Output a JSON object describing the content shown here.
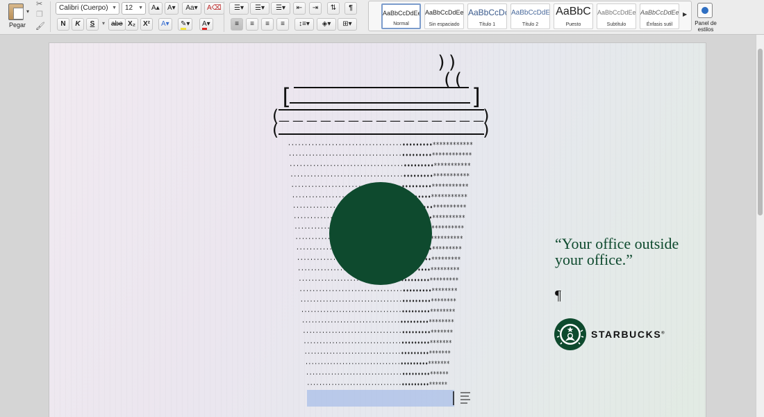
{
  "ribbon": {
    "paste_label": "Pegar",
    "font_name": "Calibri (Cuerpo)",
    "font_size": "12",
    "grow_font": "A▴",
    "shrink_font": "A▾",
    "bold": "N",
    "italic": "K",
    "underline": "S",
    "strikethrough": "abe",
    "subscript": "X₂",
    "superscript": "X²",
    "pilcrow": "¶",
    "styles": [
      {
        "sample": "AaBbCcDdEe",
        "name": "Normal",
        "selected": true
      },
      {
        "sample": "AaBbCcDdEe",
        "name": "Sin espaciado"
      },
      {
        "sample": "AaBbCcDc",
        "name": "Título 1"
      },
      {
        "sample": "AaBbCcDdEe",
        "name": "Título 2"
      },
      {
        "sample": "AaBbC",
        "name": "Puesto"
      },
      {
        "sample": "AaBbCcDdEe",
        "name": "Subtítulo"
      },
      {
        "sample": "AaBbCcDdEe",
        "name": "Énfasis sutil"
      }
    ],
    "styles_pane_label": "Panel de estilos"
  },
  "ad": {
    "steam_lines": [
      "))",
      "(("
    ],
    "lid_brackets": [
      "[",
      "]"
    ],
    "lid_parens": [
      "(",
      ")"
    ],
    "dash_row": "— — — — — — — — — — — — — — —",
    "cup_dot_char": "·",
    "cup_bullet_char": "•",
    "cup_star_char": "*",
    "quote": "“Your office outside your office.”",
    "pilcrow": "¶",
    "brand_name": "STARBUCKS",
    "brand_mark": "®",
    "colors": {
      "green": "#0e4a2e",
      "selection": "#a9bfe8"
    }
  }
}
